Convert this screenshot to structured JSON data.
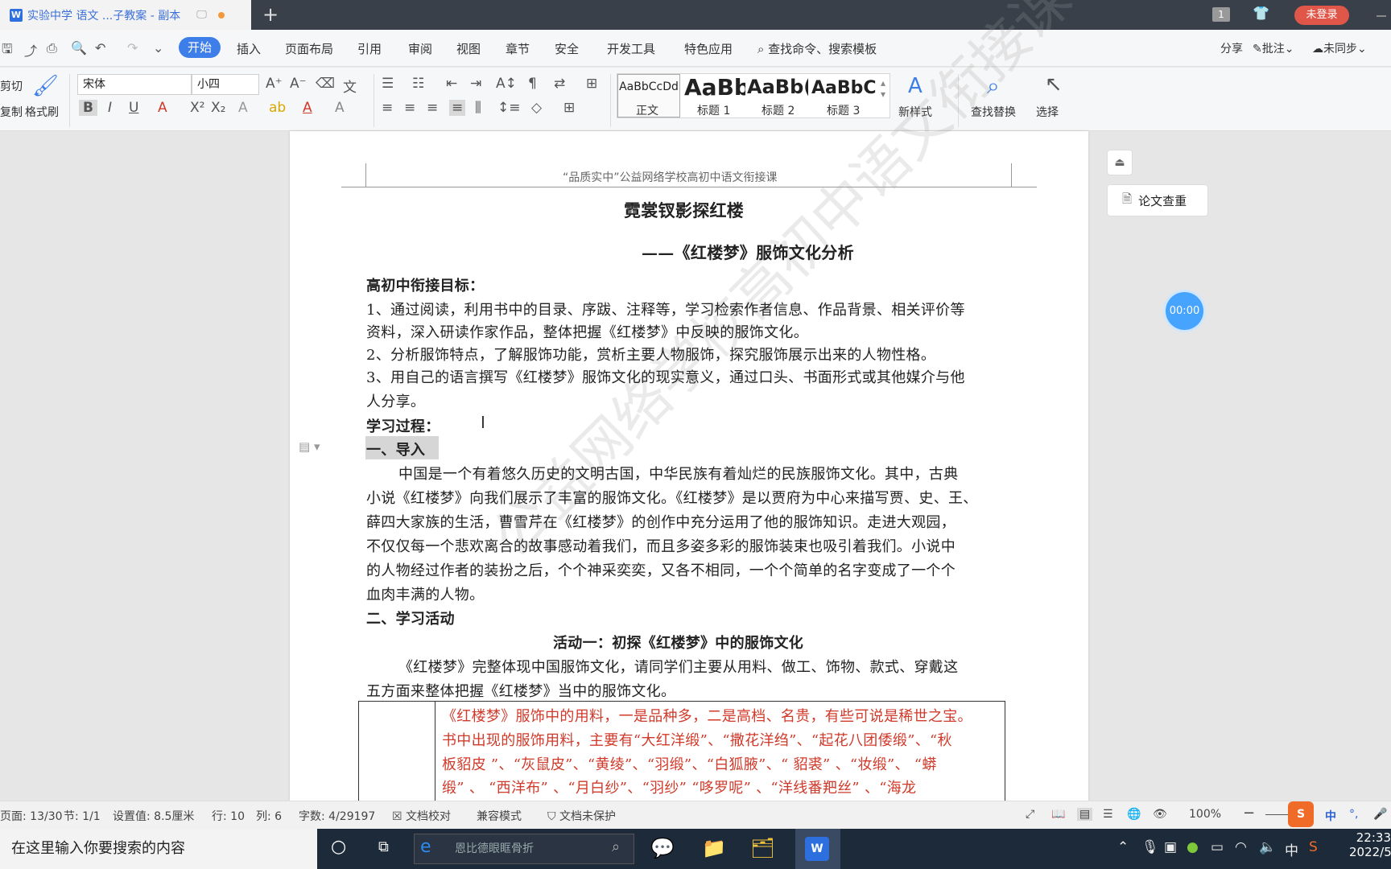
{
  "titlebar": {
    "tab_title": "实验中学 语文 ...子教案 - 副本",
    "login": "未登录",
    "badge": "1"
  },
  "menu": {
    "start": "开始",
    "items": [
      "插入",
      "页面布局",
      "引用",
      "审阅",
      "视图",
      "章节",
      "安全",
      "开发工具",
      "特色应用"
    ],
    "search": "查找命令、搜索模板",
    "share": "分享",
    "comment": "批注",
    "sync": "未同步"
  },
  "ribbon": {
    "cut": "剪切",
    "copy": "复制",
    "format_painter": "格式刷",
    "font": "宋体",
    "size": "小四",
    "styles": [
      {
        "preview": "AaBbCcDd",
        "label": "正文"
      },
      {
        "preview": "AaBb",
        "label": "标题 1"
      },
      {
        "preview": "AaBb(",
        "label": "标题 2"
      },
      {
        "preview": "AaBbC(",
        "label": "标题 3"
      }
    ],
    "new_style": "新样式",
    "find_replace": "查找替换",
    "select": "选择"
  },
  "doc": {
    "header": "“品质实中”公益网络学校高初中语文衔接课",
    "title": "霓裳钗影探红楼",
    "subtitle": "——《红楼梦》服饰文化分析",
    "goal_heading": "高初中衔接目标：",
    "goals": [
      "1、通过阅读，利用书中的目录、序跋、注释等，学习检索作者信息、作品背景、相关评价等",
      "资料，深入研读作家作品，整体把握《红楼梦》中反映的服饰文化。",
      "2、分析服饰特点，了解服饰功能，赏析主要人物服饰，探究服饰展示出来的人物性格。",
      "3、用自己的语言撰写《红楼梦》服饰文化的现实意义，通过口头、书面形式或其他媒介与他",
      "人分享。"
    ],
    "process_heading": "学习过程：",
    "section1": "一、导入",
    "intro": [
      "中国是一个有着悠久历史的文明古国，中华民族有着灿烂的民族服饰文化。其中，古典",
      "小说《红楼梦》向我们展示了丰富的服饰文化。《红楼梦》是以贾府为中心来描写贾、史、王、",
      "薛四大家族的生活，曹雪芹在《红楼梦》的创作中充分运用了他的服饰知识。走进大观园，",
      "不仅仅每一个悲欢离合的故事感动着我们，而且多姿多彩的服饰装束也吸引着我们。小说中",
      "的人物经过作者的装扮之后，个个神采奕奕，又各不相同，一个个简单的名字变成了一个个",
      "血肉丰满的人物。"
    ],
    "section2": "二、学习活动",
    "activity1": "活动一：初探《红楼梦》中的服饰文化",
    "activity_text": [
      "《红楼梦》完整体现中国服饰文化，请同学们主要从用料、做工、饰物、款式、穿戴这",
      "五方面来整体把握《红楼梦》当中的服饰文化。"
    ],
    "table_lines": [
      "《红楼梦》服饰中的用料，一是品种多，二是高档、名贵，有些可说是稀世之宝。",
      "书中出现的服饰用料，主要有“大红洋缎”、“撒花洋绉”、“起花八团倭缎”、“秋",
      "板貂皮 ”、“灰鼠皮”、“黄绫”、“羽缎”、“白狐腋”、“ 貂裘” 、“妆缎”、 “蟒",
      "缎” 、 “西洋布” 、“月白纱”、“羽纱”  “哆罗呢” 、“洋线番羓丝” 、“海龙"
    ],
    "watermark": "公益网络学校高初中语文衔接课"
  },
  "side": {
    "review": "论文查重",
    "timer": "00:00"
  },
  "status": {
    "page": "页面: 13/30",
    "section": "节: 1/1",
    "setting": "设置值: 8.5厘米",
    "row": "行: 10",
    "col": "列: 6",
    "words": "字数: 4/29197",
    "proof": "文档校对",
    "compat": "兼容模式",
    "protect": "文档未保护",
    "zoom": "100%"
  },
  "taskbar": {
    "search": "在这里输入你要搜索的内容",
    "browser_search": "恩比德眼眶骨折",
    "time": "22:33",
    "date": "2022/5"
  }
}
